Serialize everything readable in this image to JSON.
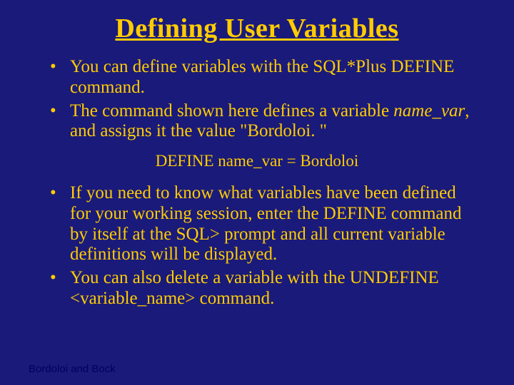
{
  "title": "Defining User Variables",
  "bullets_top": [
    {
      "pre": "You can define variables with the SQL*Plus DEFINE command.",
      "var": "",
      "post": ""
    },
    {
      "pre": "The command shown here defines a variable ",
      "var": "name_var",
      "post": ", and assigns it the value \"Bordoloi. \""
    }
  ],
  "code": "DEFINE name_var = Bordoloi",
  "bullets_bottom": [
    "If you need to know what variables have been defined for your working session, enter the DEFINE command by itself at the SQL> prompt and all current variable definitions will be displayed.",
    "You can also delete a variable with the UNDEFINE <variable_name> command."
  ],
  "footer": "Bordoloi and Bock"
}
